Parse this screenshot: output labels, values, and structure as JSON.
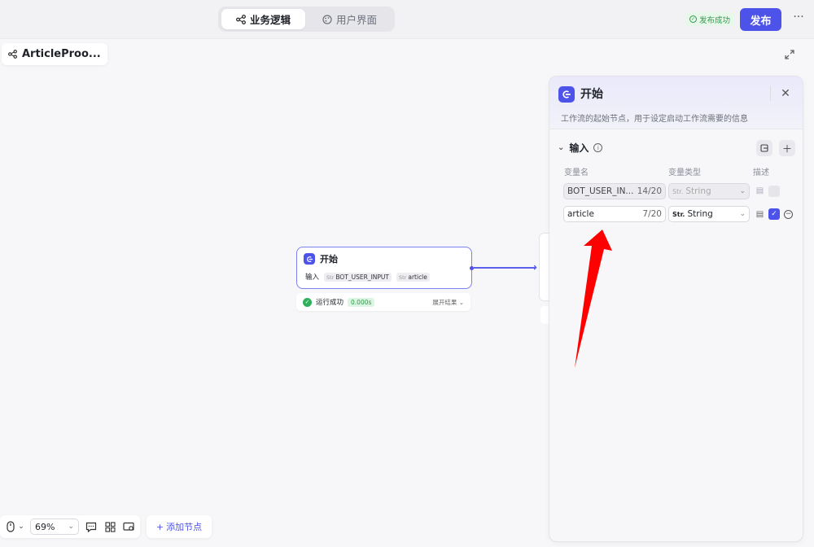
{
  "tabs": [
    {
      "label": "业务逻辑",
      "active": true
    },
    {
      "label": "用户界面",
      "active": false
    }
  ],
  "status": {
    "label": "发布成功",
    "color": "#2c9b4a"
  },
  "publish_label": "发布",
  "more_label": "···",
  "workflow": {
    "name": "ArticleProo..."
  },
  "node": {
    "title": "开始",
    "input_label": "输入",
    "params": [
      {
        "type": "Str",
        "name": "BOT_USER_INPUT"
      },
      {
        "type": "Str",
        "name": "article"
      }
    ],
    "run_status": "运行成功",
    "duration": "0.000s",
    "expand_label": "展开结果"
  },
  "panel": {
    "title": "开始",
    "description": "工作流的起始节点，用于设定启动工作流需要的信息",
    "section_title": "输入",
    "columns": {
      "name": "变量名",
      "type": "变量类型",
      "desc": "描述"
    },
    "rows": [
      {
        "name": "BOT_USER_IN...",
        "count": "14/20",
        "type_prefix": "Str.",
        "type": "String",
        "checked": false,
        "disabled": true
      },
      {
        "name": "article",
        "count": "7/20",
        "type_prefix": "Str.",
        "type": "String",
        "checked": true,
        "disabled": false
      }
    ]
  },
  "toolbar": {
    "zoom": "69%",
    "add_node_label": "添加节点"
  },
  "colors": {
    "accent": "#4d53e8",
    "success": "#2eb15a",
    "annotation": "#ff0000"
  },
  "icons": [
    "share-icon",
    "palette-icon",
    "check-circle-icon",
    "expand-icon",
    "close-icon",
    "info-icon",
    "import-icon",
    "plus-icon",
    "note-icon",
    "minus-circle-icon",
    "mouse-icon",
    "comment-icon",
    "grid-icon",
    "monitor-icon"
  ]
}
